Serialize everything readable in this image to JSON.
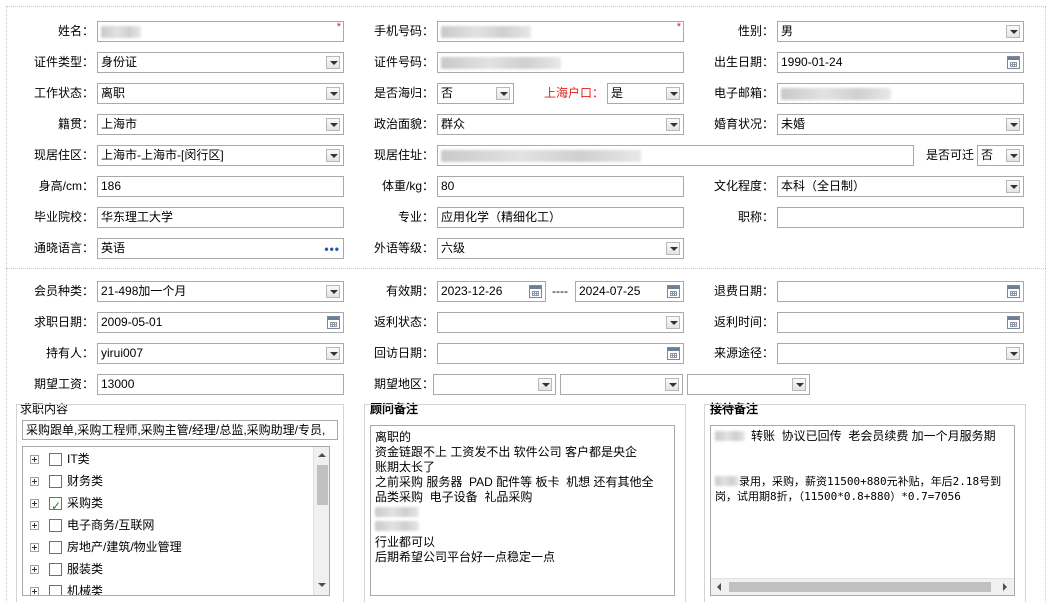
{
  "labels": {
    "name": "姓名：",
    "phone": "手机号码：",
    "gender": "性别：",
    "id_type": "证件类型：",
    "id_number": "证件号码：",
    "birth_date": "出生日期：",
    "work_status": "工作状态：",
    "returnee": "是否海归：",
    "shanghai_hukou": "上海户口：",
    "email": "电子邮箱：",
    "native_place": "籍贯：",
    "political_status": "政治面貌：",
    "marital_status": "婚育状况：",
    "current_residence": "现居住区：",
    "current_address": "现居住址：",
    "relocate": "是否可迁",
    "height": "身高/cm：",
    "weight": "体重/kg：",
    "education": "文化程度：",
    "school": "毕业院校：",
    "major": "专业：",
    "title": "职称：",
    "languages": "通晓语言：",
    "language_level": "外语等级：",
    "member_type": "会员种类：",
    "validity": "有效期：",
    "validity_sep": "----",
    "refund_date": "退费日期：",
    "job_search_date": "求职日期：",
    "rebate_status": "返利状态：",
    "rebate_time": "返利时间：",
    "holder": "持有人：",
    "visit_date": "回访日期：",
    "source": "来源途径：",
    "expected_salary": "期望工资：",
    "expected_area": "期望地区："
  },
  "values": {
    "gender": "男",
    "id_type": "身份证",
    "birth_date": "1990-01-24",
    "work_status": "离职",
    "returnee": "否",
    "shanghai_hukou": "是",
    "native_place": "上海市",
    "political_status": "群众",
    "marital_status": "未婚",
    "current_residence": "上海市-上海市-[闵行区]",
    "relocate": "否",
    "height": "186",
    "weight": "80",
    "education": "本科（全日制）",
    "school": "华东理工大学",
    "major": "应用化学（精细化工）",
    "title": "",
    "languages": "英语",
    "language_level": "六级",
    "member_type": "21-498加一个月",
    "validity_start": "2023-12-26",
    "validity_end": "2024-07-25",
    "refund_date": "",
    "job_search_date": "2009-05-01",
    "rebate_status": "",
    "rebate_time": "",
    "holder": "yirui007",
    "visit_date": "",
    "source": "",
    "expected_salary": "13000",
    "expected_area_1": "",
    "expected_area_2": "",
    "expected_area_3": ""
  },
  "job_content": {
    "title": "求职内容",
    "summary": "采购跟单,采购工程师,采购主管/经理/总监,采购助理/专员,",
    "categories": [
      {
        "label": "IT类",
        "checked": false
      },
      {
        "label": "财务类",
        "checked": false
      },
      {
        "label": "采购类",
        "checked": true
      },
      {
        "label": "电子商务/互联网",
        "checked": false
      },
      {
        "label": "房地产/建筑/物业管理",
        "checked": false
      },
      {
        "label": "服装类",
        "checked": false
      },
      {
        "label": "机械类",
        "checked": false
      }
    ]
  },
  "consultant_notes": {
    "title": "顾问备注",
    "lines": [
      "离职的",
      "资金链跟不上 工资发不出 软件公司 客户都是央企",
      "账期太长了",
      "之前采购 服务器  PAD 配件等 板卡  机想 还有其他全",
      "品类采购  电子设备  礼品采购",
      "",
      "",
      "行业都可以",
      "后期希望公司平台好一点稳定一点"
    ]
  },
  "reception_notes": {
    "title": "接待备注",
    "line1": "转账  协议已回传  老会员续费 加一个月服务期",
    "line2a": "录用，采购，薪资11500+880元补贴，年后2.18号到",
    "line2b": "岗，试用期8折，（11500*0.8+880）*0.7=7056"
  },
  "colors": {
    "required_mark": "#e02020",
    "hukou_label": "#e02020",
    "border": "#a9a9a9"
  }
}
